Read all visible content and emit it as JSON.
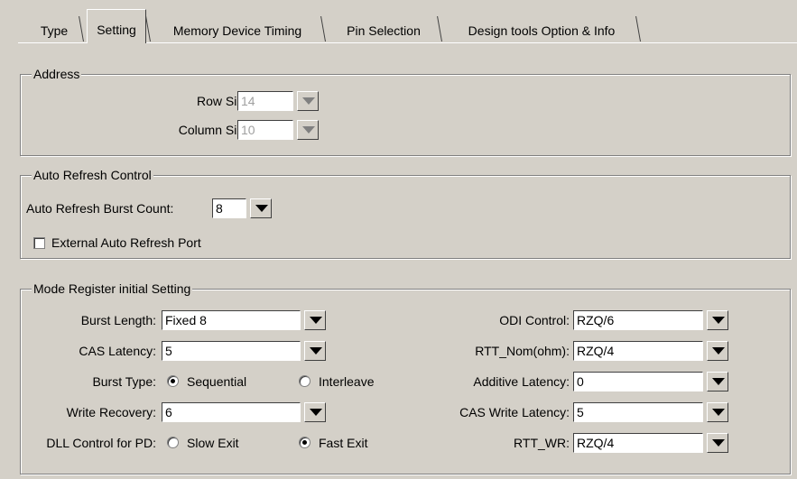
{
  "tabs": [
    {
      "label": "Type"
    },
    {
      "label": "Setting"
    },
    {
      "label": "Memory Device Timing"
    },
    {
      "label": "Pin Selection"
    },
    {
      "label": "Design tools Option & Info"
    }
  ],
  "address": {
    "legend": "Address",
    "row_size": {
      "label": "Row Size:",
      "value": "14"
    },
    "column_size": {
      "label": "Column Size:",
      "value": "10"
    }
  },
  "auto_refresh": {
    "legend": "Auto Refresh Control",
    "burst_count": {
      "label": "Auto Refresh Burst Count:",
      "value": "8"
    },
    "external_port": {
      "label": "External Auto Refresh Port",
      "checked": false
    }
  },
  "mode_register": {
    "legend": "Mode Register initial Setting",
    "burst_length": {
      "label": "Burst Length:",
      "value": "Fixed 8"
    },
    "cas_latency": {
      "label": "CAS Latency:",
      "value": "5"
    },
    "burst_type": {
      "label": "Burst Type:",
      "option1": "Sequential",
      "option2": "Interleave",
      "selected": "Sequential"
    },
    "write_recovery": {
      "label": "Write Recovery:",
      "value": "6"
    },
    "dll_control": {
      "label": "DLL Control for PD:",
      "option1": "Slow Exit",
      "option2": "Fast Exit",
      "selected": "Fast Exit"
    },
    "odi_control": {
      "label": "ODI Control:",
      "value": "RZQ/6"
    },
    "rtt_nom": {
      "label": "RTT_Nom(ohm):",
      "value": "RZQ/4"
    },
    "additive_latency": {
      "label": "Additive Latency:",
      "value": "0"
    },
    "cas_write_latency": {
      "label": "CAS Write Latency:",
      "value": "5"
    },
    "rtt_wr": {
      "label": "RTT_WR:",
      "value": "RZQ/4"
    }
  }
}
